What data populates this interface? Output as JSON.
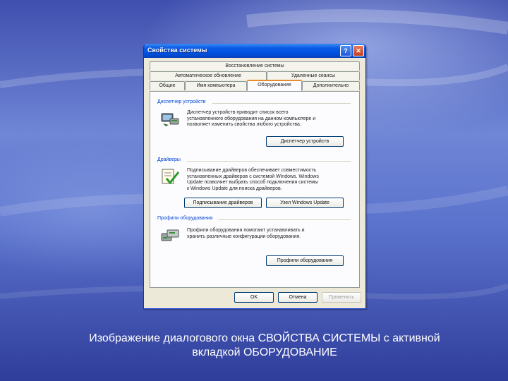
{
  "dialog": {
    "title": "Свойства системы",
    "help_button": "?",
    "close_button": "✕"
  },
  "tabs": {
    "row1": [
      "Восстановление системы"
    ],
    "row2": [
      "Автоматическое обновление",
      "Удаленные сеансы"
    ],
    "row3": [
      "Общие",
      "Имя компьютера",
      "Оборудование",
      "Дополнительно"
    ],
    "active": "Оборудование"
  },
  "device_manager": {
    "title": "Диспетчер устройств",
    "lines": [
      "Диспетчер устройств приводит список всего",
      "установленного оборудования на данном компьютере и",
      "позволяет изменить свойства любого устройства."
    ],
    "button": "Диспетчер устройств"
  },
  "drivers": {
    "title": "Драйверы",
    "lines": [
      "Подписывание драйверов обеспечивает совместимость",
      "установленных драйверов с системой Windows. Windows",
      "Update позволяет выбрать способ подключения системы",
      "к Windows Update для поиска драйверов."
    ],
    "button_signing": "Подписывание драйверов",
    "button_update": "Узел Windows Update"
  },
  "hardware_profiles": {
    "title": "Профили оборудования",
    "lines": [
      "Профили оборудования помогают устанавливать и",
      "хранить различные конфигурации оборудования."
    ],
    "button": "Профили оборудования"
  },
  "footer": {
    "ok": "OK",
    "cancel": "Отмена",
    "apply": "Применить"
  },
  "caption": {
    "line1": "Изображение диалогового окна СВОЙСТВА СИСТЕМЫ с активной",
    "line2": "вкладкой ОБОРУДОВАНИЕ"
  },
  "colors": {
    "titlebar": "#0a5ce6",
    "dialog_bg": "#ece9d8",
    "group_title": "#0046d5",
    "active_tab_accent": "#e68b2c"
  },
  "icons": {
    "device_manager": "device-manager-icon",
    "drivers": "driver-signing-icon",
    "hardware_profiles": "hardware-profiles-icon"
  }
}
